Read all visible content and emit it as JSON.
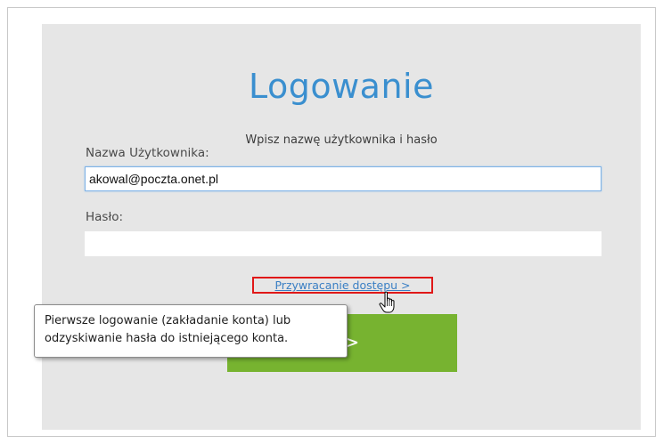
{
  "login": {
    "title": "Logowanie",
    "subtitle": "Wpisz nazwę użytkownika i hasło",
    "username_label": "Nazwa Użytkownika:",
    "username_value": "akowal@poczta.onet.pl",
    "password_label": "Hasło:",
    "password_value": "",
    "recovery_link": "Przywracanie dostępu >",
    "button_label_visible": "ę >"
  },
  "tooltip": {
    "line1": "Pierwsze logowanie (zakładanie konta) lub",
    "line2": "odzyskiwanie hasła do istniejącego konta."
  },
  "colors": {
    "title": "#3a8fcf",
    "button": "#77b330",
    "highlight_border": "#e01818",
    "link": "#3a7fc4",
    "panel": "#e6e6e6"
  },
  "icons": {
    "cursor": "hand-pointer-icon"
  }
}
